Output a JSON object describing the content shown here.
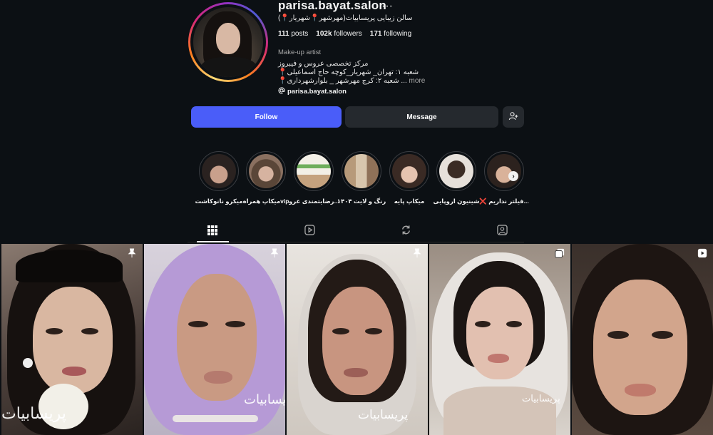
{
  "profile": {
    "username": "parisa.bayat.salon",
    "more_options": "···",
    "full_name": "سالن زیبایی پریسابیات(مهرشهر📍شهریار📍)",
    "stats": {
      "posts_count": "111",
      "posts_label": "posts",
      "followers_count": "102k",
      "followers_label": "followers",
      "following_count": "171",
      "following_label": "following"
    },
    "category": "Make-up artist",
    "bio_lines": [
      "مرکز تخصصی عروس و فیبروز",
      "📍شعبه ۱: تهران_ شهریار_کوچه حاج اسماعیلی",
      "📍شعبه ۲: کرج مهرشهر _ بلوارشهرداری ..."
    ],
    "bio_more": "more",
    "threads_handle": "parisa.bayat.salon"
  },
  "actions": {
    "follow_label": "Follow",
    "message_label": "Message"
  },
  "highlights": [
    {
      "label": "میکرو نانوکاشت"
    },
    {
      "label": "میکاپ همراهvip"
    },
    {
      "label": "رضایتمندی عرو..."
    },
    {
      "label": "رنگ و لایت ۱۴۰۴"
    },
    {
      "label": "میکاپ پایه"
    },
    {
      "label": "شینیون اروپایی"
    },
    {
      "label": "❌ فیلتر نداریم..."
    }
  ],
  "posts": [
    {
      "watermark": "پریسابیات",
      "corner": "pin-icon"
    },
    {
      "watermark": "پریسابیات",
      "corner": "pin-icon"
    },
    {
      "watermark": "پریسابیات",
      "corner": "pin-icon"
    },
    {
      "watermark": "پریسابیات",
      "corner": "carousel-icon"
    },
    {
      "watermark": "",
      "corner": "reel-icon"
    }
  ],
  "colors": {
    "background": "#0c1014",
    "follow_button": "#4a5df9",
    "secondary_button": "#25292e"
  }
}
